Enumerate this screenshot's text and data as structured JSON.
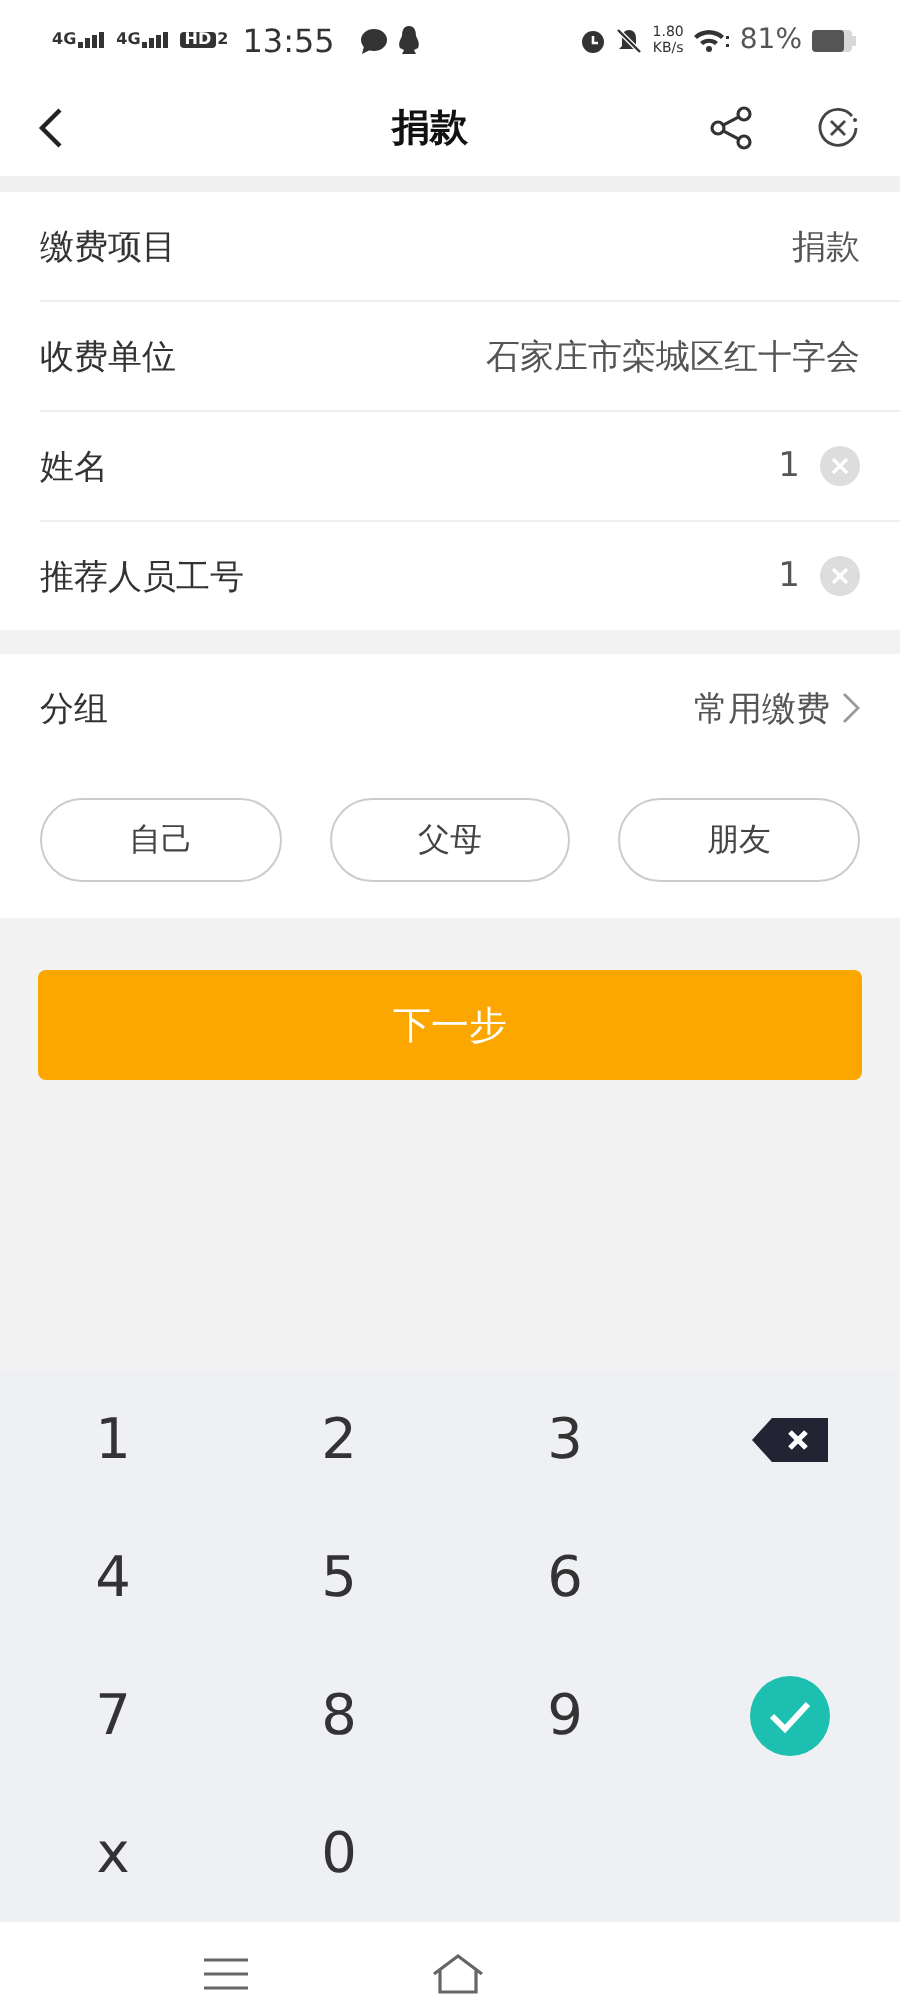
{
  "status_bar": {
    "networks": [
      "4G",
      "4G"
    ],
    "hd": "HD",
    "hd_sub": "2",
    "time": "13:55",
    "speed": "1.80",
    "speed_unit": "KB/s",
    "battery": "81%"
  },
  "header": {
    "title": "捐款"
  },
  "fields": [
    {
      "label": "缴费项目",
      "value": "捐款",
      "kind": "text"
    },
    {
      "label": "收费单位",
      "value": "石家庄市栾城区红十字会",
      "kind": "text"
    },
    {
      "label": "姓名",
      "value": "1",
      "kind": "input"
    },
    {
      "label": "推荐人员工号",
      "value": "1",
      "kind": "input"
    }
  ],
  "group": {
    "label": "分组",
    "value": "常用缴费"
  },
  "chips": [
    {
      "label": "自己",
      "selected": false
    },
    {
      "label": "父母",
      "selected": false
    },
    {
      "label": "朋友",
      "selected": false
    }
  ],
  "next_button": "下一步",
  "keypad": {
    "keys": [
      "1",
      "2",
      "3",
      "4",
      "5",
      "6",
      "7",
      "8",
      "9",
      "x",
      "0"
    ]
  }
}
